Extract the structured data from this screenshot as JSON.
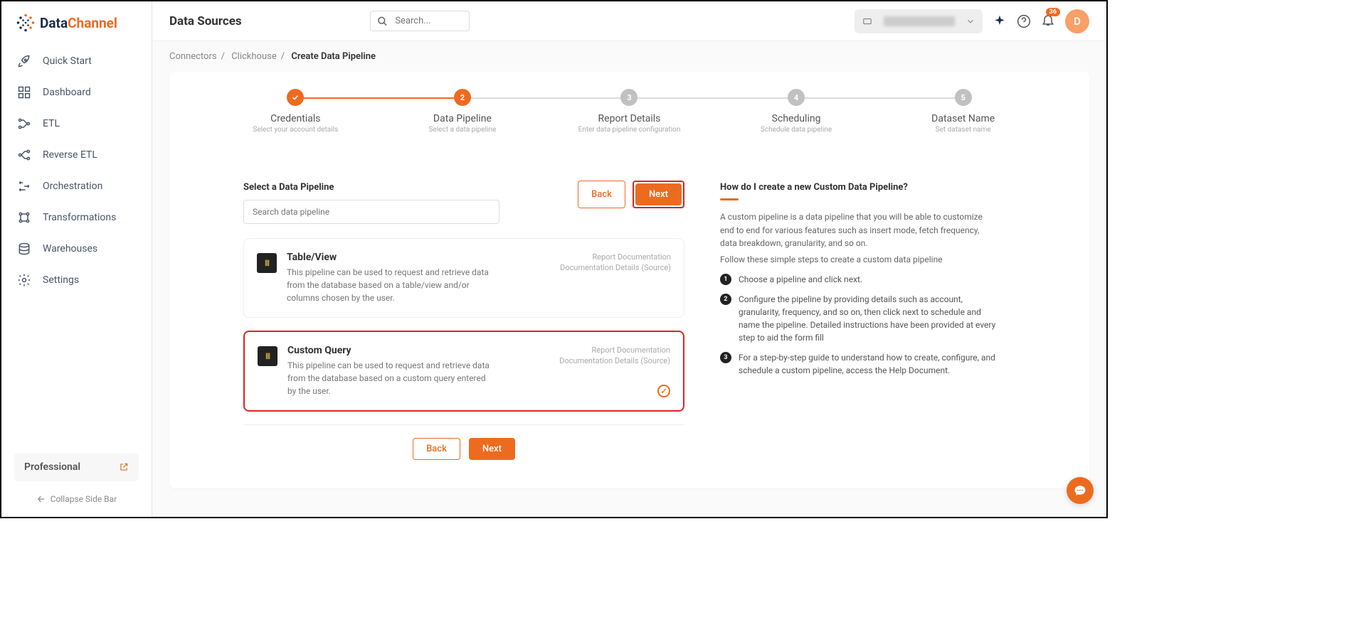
{
  "brand": {
    "data": "Data",
    "channel": "Channel"
  },
  "nav": {
    "quick_start": "Quick Start",
    "dashboard": "Dashboard",
    "etl": "ETL",
    "reverse_etl": "Reverse ETL",
    "orchestration": "Orchestration",
    "transformations": "Transformations",
    "warehouses": "Warehouses",
    "settings": "Settings"
  },
  "plan": "Professional",
  "collapse": "Collapse Side Bar",
  "page_title": "Data Sources",
  "search_placeholder": "Search...",
  "notif_count": "36",
  "avatar_letter": "D",
  "crumbs": {
    "c1": "Connectors",
    "c2": "Clickhouse",
    "c3": "Create Data Pipeline"
  },
  "steps": [
    {
      "title": "Credentials",
      "sub": "Select your account details",
      "state": "done",
      "num": "✓"
    },
    {
      "title": "Data Pipeline",
      "sub": "Select a data pipeline",
      "state": "current",
      "num": "2"
    },
    {
      "title": "Report Details",
      "sub": "Enter data pipeline configuration",
      "state": "pending",
      "num": "3"
    },
    {
      "title": "Scheduling",
      "sub": "Schedule data pipeline",
      "state": "pending",
      "num": "4"
    },
    {
      "title": "Dataset Name",
      "sub": "Set dataset name",
      "state": "pending",
      "num": "5"
    }
  ],
  "select_title": "Select a Data Pipeline",
  "pipe_search_placeholder": "Search data pipeline",
  "back_label": "Back",
  "next_label": "Next",
  "pipelines": [
    {
      "title": "Table/View",
      "desc": "This pipeline can be used to request and retrieve data from the database based on a table/view and/or columns chosen by the user.",
      "link1": "Report Documentation",
      "link2": "Documentation Details (Source)"
    },
    {
      "title": "Custom Query",
      "desc": "This pipeline can be used to request and retrieve data from the database based on a custom query entered by the user.",
      "link1": "Report Documentation",
      "link2": "Documentation Details (Source)"
    }
  ],
  "help": {
    "title": "How do I create a new Custom Data Pipeline?",
    "p1": "A custom pipeline is a data pipeline that you will be able to customize end to end for various features such as insert mode, fetch frequency, data breakdown, granularity, and so on.",
    "p2": "Follow these simple steps to create a custom data pipeline",
    "items": [
      "Choose a pipeline and click next.",
      "Configure the pipeline by providing details such as account, granularity, frequency, and so on, then click next to schedule and name the pipeline. Detailed instructions have been provided at every step to aid the form fill",
      "For a step-by-step guide to understand how to create, configure, and schedule a custom pipeline, access the Help Document."
    ]
  }
}
